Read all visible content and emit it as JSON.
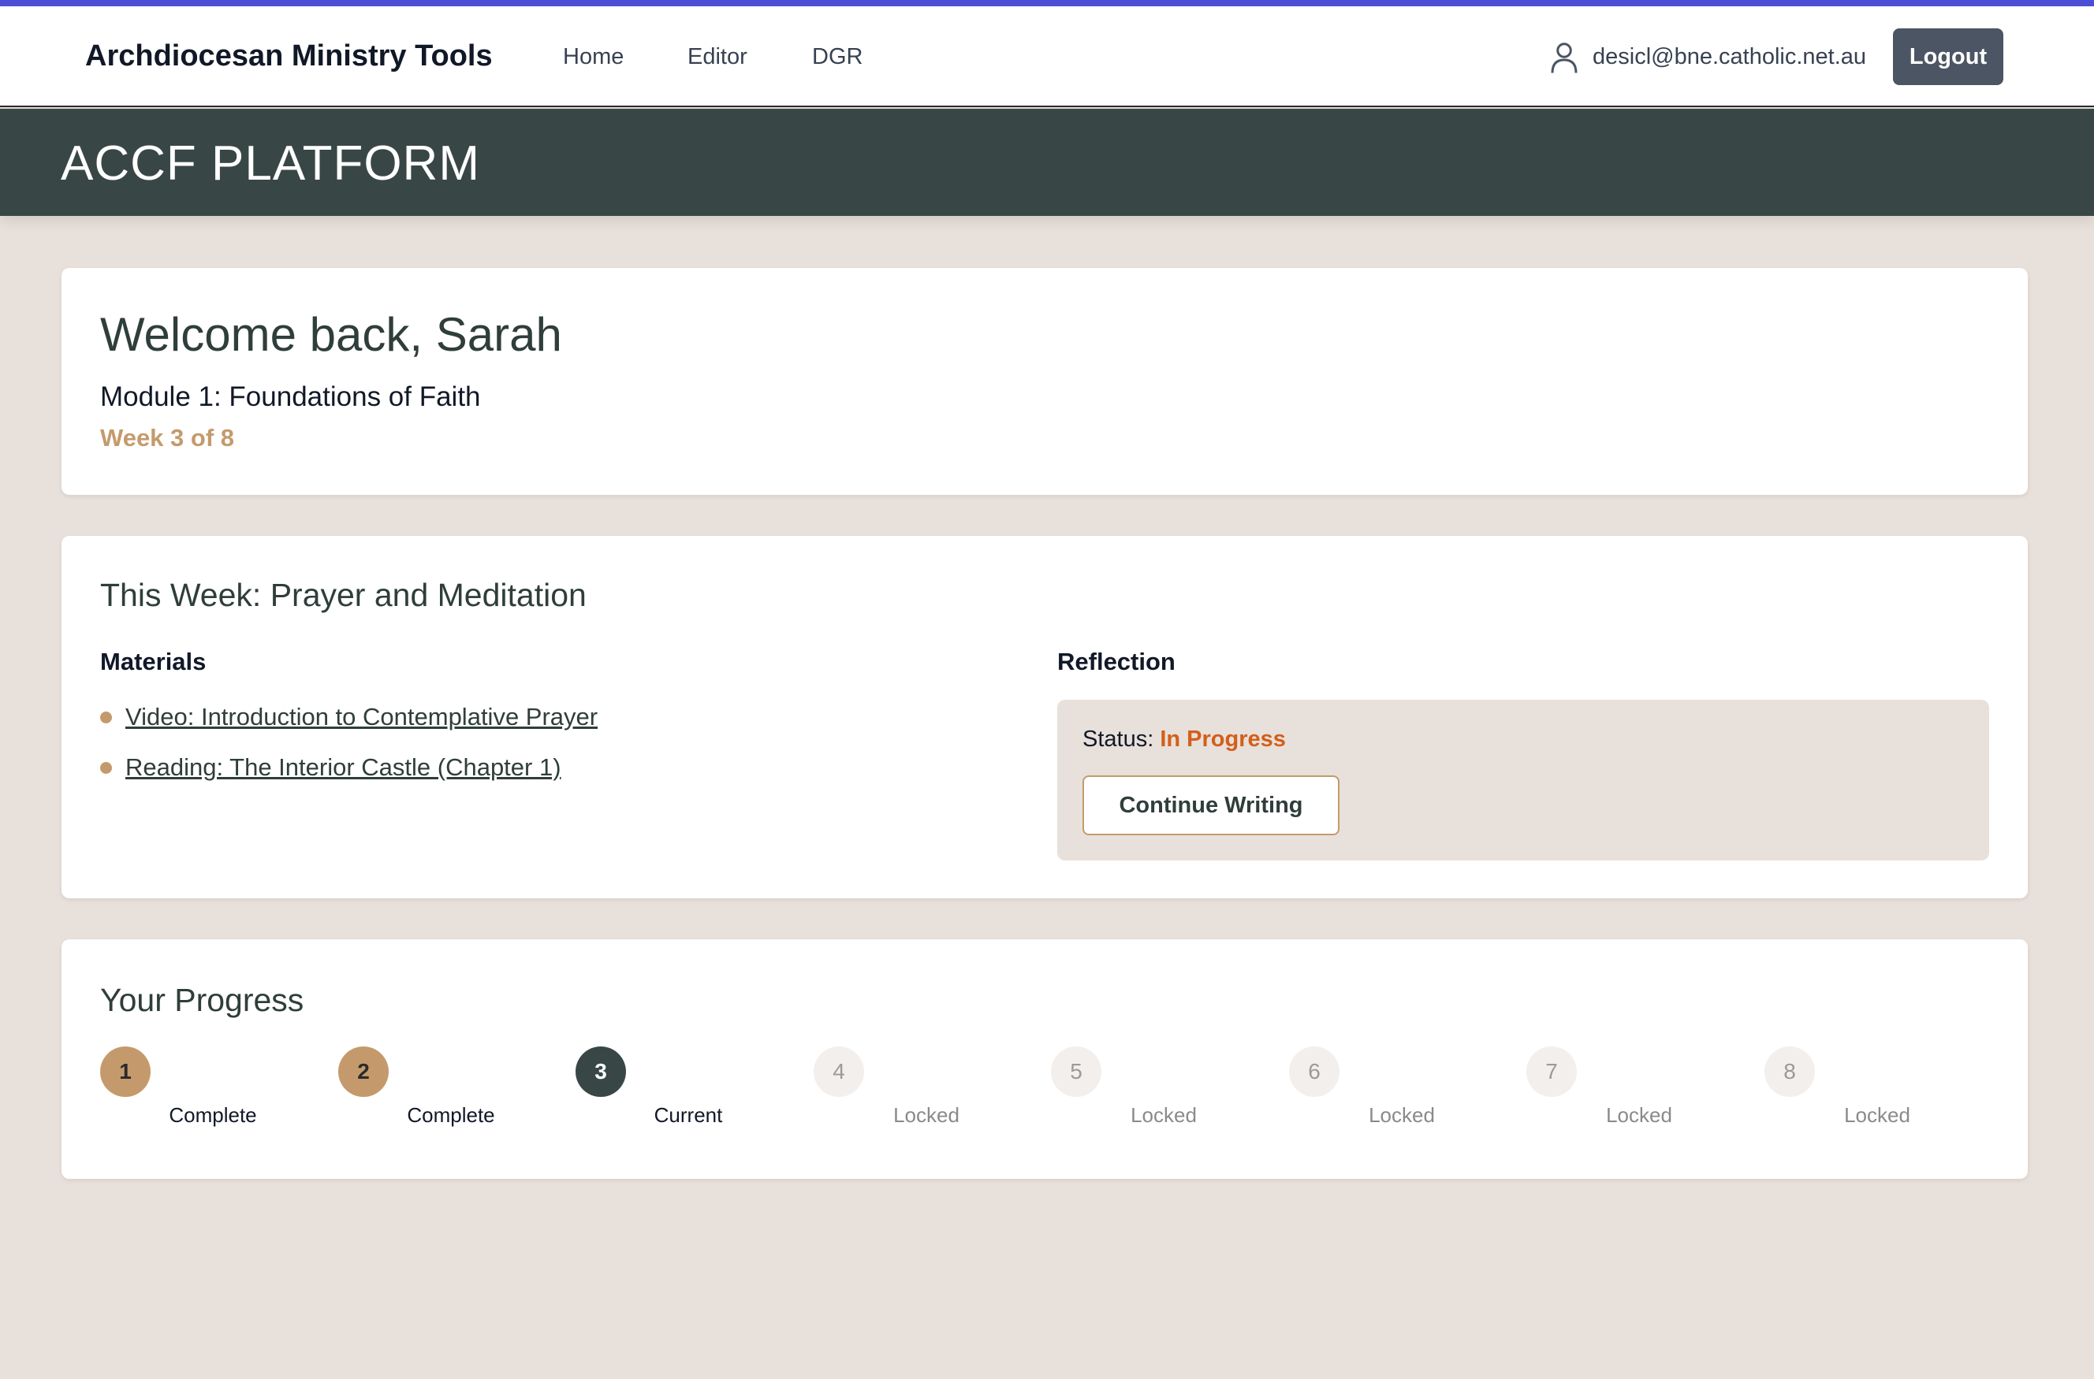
{
  "navbar": {
    "brand": "Archdiocesan Ministry Tools",
    "links": [
      "Home",
      "Editor",
      "DGR"
    ],
    "user_email": "desicl@bne.catholic.net.au",
    "logout_label": "Logout"
  },
  "banner": {
    "title": "ACCF PLATFORM"
  },
  "welcome": {
    "title": "Welcome back, Sarah",
    "module": "Module 1: Foundations of Faith",
    "week": "Week 3 of 8"
  },
  "this_week": {
    "title": "This Week: Prayer and Meditation",
    "materials_heading": "Materials",
    "materials": [
      "Video: Introduction to Contemplative Prayer",
      "Reading: The Interior Castle (Chapter 1)"
    ],
    "reflection_heading": "Reflection",
    "status_label": "Status:",
    "status_value": "In Progress",
    "continue_label": "Continue Writing"
  },
  "progress": {
    "title": "Your Progress",
    "steps": [
      {
        "number": "1",
        "label": "Complete"
      },
      {
        "number": "2",
        "label": "Complete"
      },
      {
        "number": "3",
        "label": "Current"
      },
      {
        "number": "4",
        "label": "Locked"
      },
      {
        "number": "5",
        "label": "Locked"
      },
      {
        "number": "6",
        "label": "Locked"
      },
      {
        "number": "7",
        "label": "Locked"
      },
      {
        "number": "8",
        "label": "Locked"
      }
    ]
  },
  "colors": {
    "accent_tan": "#c49a6c",
    "dark_green": "#384745",
    "status_orange": "#d35f1b",
    "background": "#e8e0da"
  }
}
